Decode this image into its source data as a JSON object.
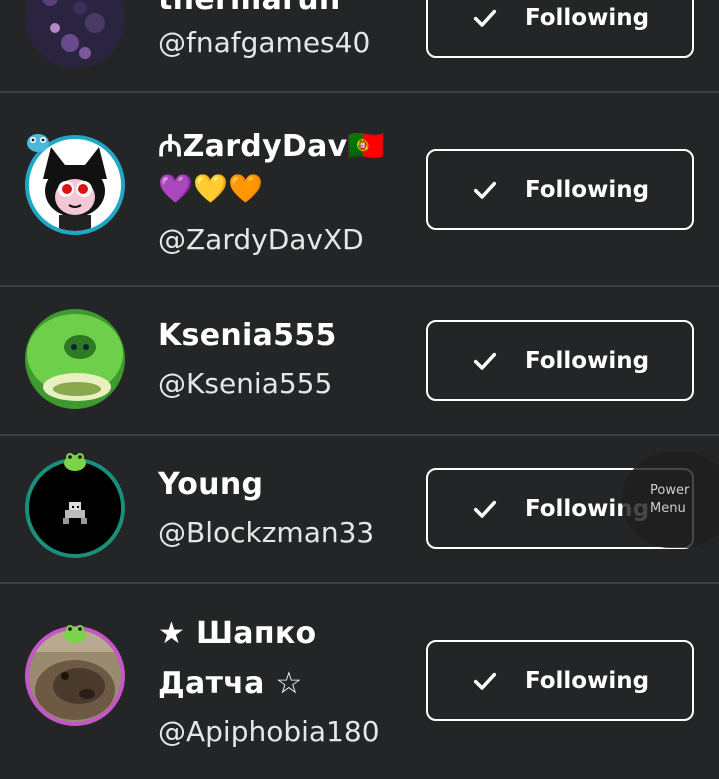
{
  "users": [
    {
      "name": "thermarun",
      "handle": "@fnafgames40",
      "button": "Following"
    },
    {
      "name": "₼ZardyDav🇵🇹",
      "name_line2": "💜💛🧡",
      "handle": "@ZardyDavXD",
      "button": "Following"
    },
    {
      "name": "Ksenia555",
      "handle": "@Ksenia555",
      "button": "Following"
    },
    {
      "name": "Young",
      "handle": "@Blockzman33",
      "button": "Following"
    },
    {
      "name": "★ Шапко",
      "name_line2": "Датча ☆",
      "handle": "@Apiphobia180",
      "button": "Following"
    }
  ],
  "power_menu": {
    "line1": "Power",
    "line2": "Menu"
  },
  "colors": {
    "background": "#232527",
    "divider": "#3b3e42",
    "text": "#ffffff"
  }
}
